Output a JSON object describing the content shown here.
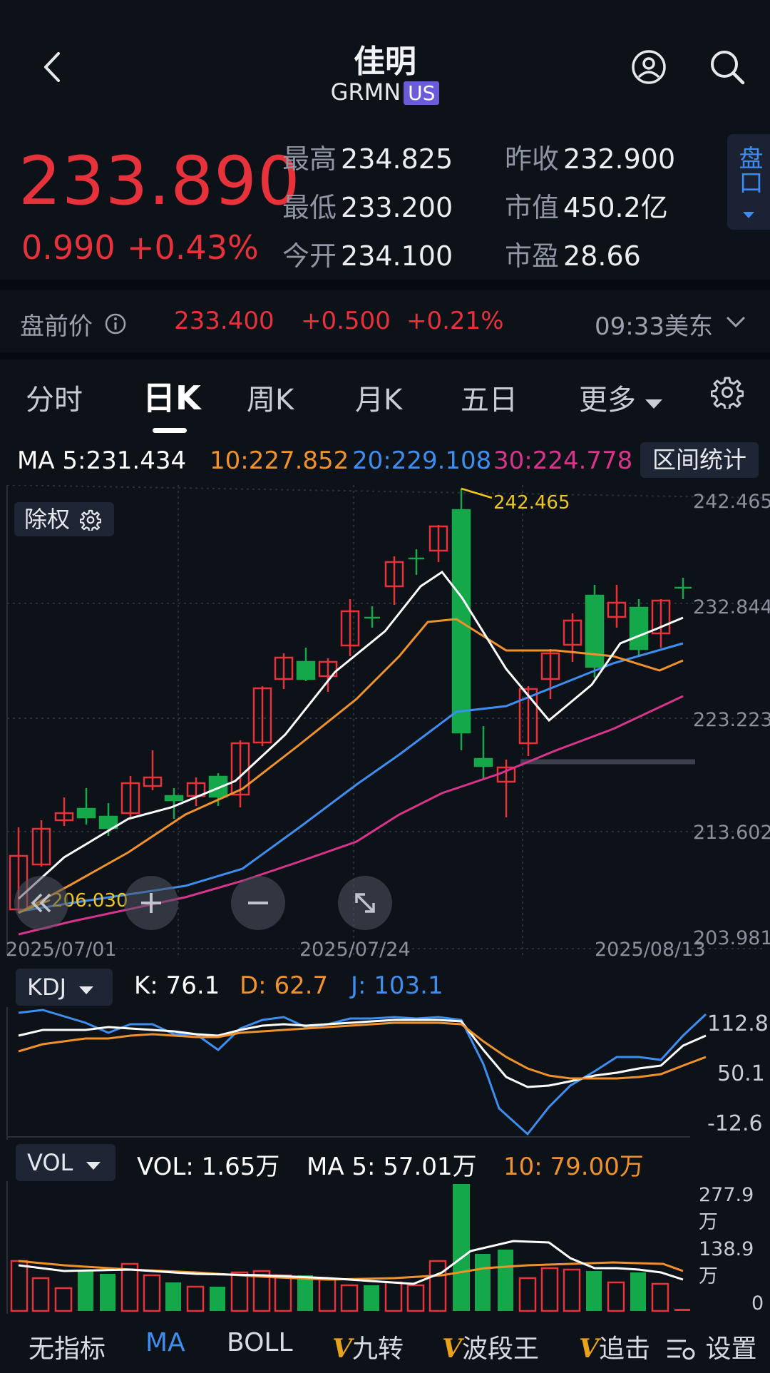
{
  "header": {
    "back_icon": "chevron-left-icon",
    "title": "佳明",
    "ticker": "GRMN",
    "market_badge": "US",
    "profile_icon": "user-circle-icon",
    "search_icon": "search-icon"
  },
  "quote": {
    "price": "233.890",
    "change": "0.990",
    "change_pct": "+0.43%",
    "high_label": "最高",
    "high": "234.825",
    "low_label": "最低",
    "low": "233.200",
    "open_label": "今开",
    "open": "234.100",
    "prev_close_label": "昨收",
    "prev_close": "232.900",
    "mkt_cap_label": "市值",
    "mkt_cap": "450.2亿",
    "pe_label": "市盈",
    "pe": "28.66",
    "pankou_label": "盘口",
    "up_color": "#e8323b",
    "down_color": "#14a84a"
  },
  "premarket": {
    "label": "盘前价",
    "price": "233.400",
    "change": "+0.500",
    "change_pct": "+0.21%",
    "time": "09:33美东"
  },
  "tabs": {
    "items": [
      "分时",
      "日K",
      "周K",
      "月K",
      "五日",
      "更多"
    ],
    "active": "日K",
    "settings_icon": "gear-icon"
  },
  "ma_legend": {
    "ma5": "MA 5:231.434",
    "ma10": "10:227.852",
    "ma20": "20:229.108",
    "ma30": "30:224.778",
    "range_stats": "区间统计",
    "colors": {
      "ma5": "#ffffff",
      "ma10": "#f0922b",
      "ma20": "#3e8ef0",
      "ma30": "#d8348c"
    }
  },
  "kline": {
    "adjust_label": "除权",
    "y_ticks": [
      "242.465",
      "232.844",
      "223.223",
      "213.602",
      "203.981"
    ],
    "x_ticks": [
      "2025/07/01",
      "2025/07/24",
      "2025/08/13"
    ],
    "max_marker": "242.465",
    "min_marker": "206.030"
  },
  "kdj": {
    "selector": "KDJ",
    "k": "K: 76.1",
    "d": "D: 62.7",
    "j": "J: 103.1",
    "y_ticks": [
      "112.8",
      "50.1",
      "-12.6"
    ]
  },
  "vol": {
    "selector": "VOL",
    "vol": "VOL: 1.65万",
    "ma5": "MA 5: 57.01万",
    "ma10": "10: 79.00万",
    "y_ticks": [
      "277.9万",
      "138.9万",
      "0"
    ]
  },
  "bottom_bar": {
    "items": [
      "无指标",
      "MA",
      "BOLL",
      "九转",
      "波段王",
      "追击"
    ],
    "v_prefix": "V",
    "settings": "设置",
    "active": "MA"
  }
}
